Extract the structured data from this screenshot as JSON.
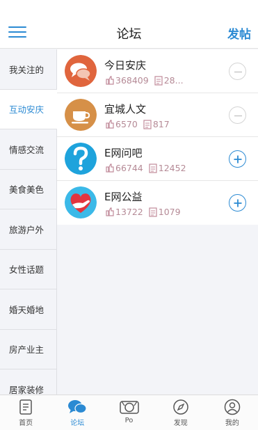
{
  "header": {
    "title": "论坛",
    "post_label": "发帖"
  },
  "sidebar": {
    "items": [
      {
        "label": "我关注的"
      },
      {
        "label": "互动安庆",
        "active": true
      },
      {
        "label": "情感交流"
      },
      {
        "label": "美食美色"
      },
      {
        "label": "旅游户外"
      },
      {
        "label": "女性话题"
      },
      {
        "label": "婚天婚地"
      },
      {
        "label": "房产业主"
      },
      {
        "label": "居家装修"
      }
    ]
  },
  "forums": [
    {
      "name": "今日安庆",
      "members": "368409",
      "posts": "28...",
      "icon": "chat-bubbles-icon",
      "state": "joined"
    },
    {
      "name": "宜城人文",
      "members": "6570",
      "posts": "817",
      "icon": "coffee-cup-icon",
      "state": "joined"
    },
    {
      "name": "E网问吧",
      "members": "66744",
      "posts": "12452",
      "icon": "question-mark-icon",
      "state": "join"
    },
    {
      "name": "E网公益",
      "members": "13722",
      "posts": "1079",
      "icon": "heart-hand-icon",
      "state": "join"
    }
  ],
  "bottom_nav": {
    "items": [
      {
        "label": "首页",
        "icon": "home-document-icon"
      },
      {
        "label": "论坛",
        "icon": "forum-bubbles-icon",
        "active": true
      },
      {
        "label": "Po",
        "icon": "camera-icon"
      },
      {
        "label": "发现",
        "icon": "compass-icon"
      },
      {
        "label": "我的",
        "icon": "user-icon"
      }
    ]
  },
  "colors": {
    "accent": "#2b8ad3",
    "stat_text": "#b58a96",
    "background": "#f3f4f8"
  }
}
